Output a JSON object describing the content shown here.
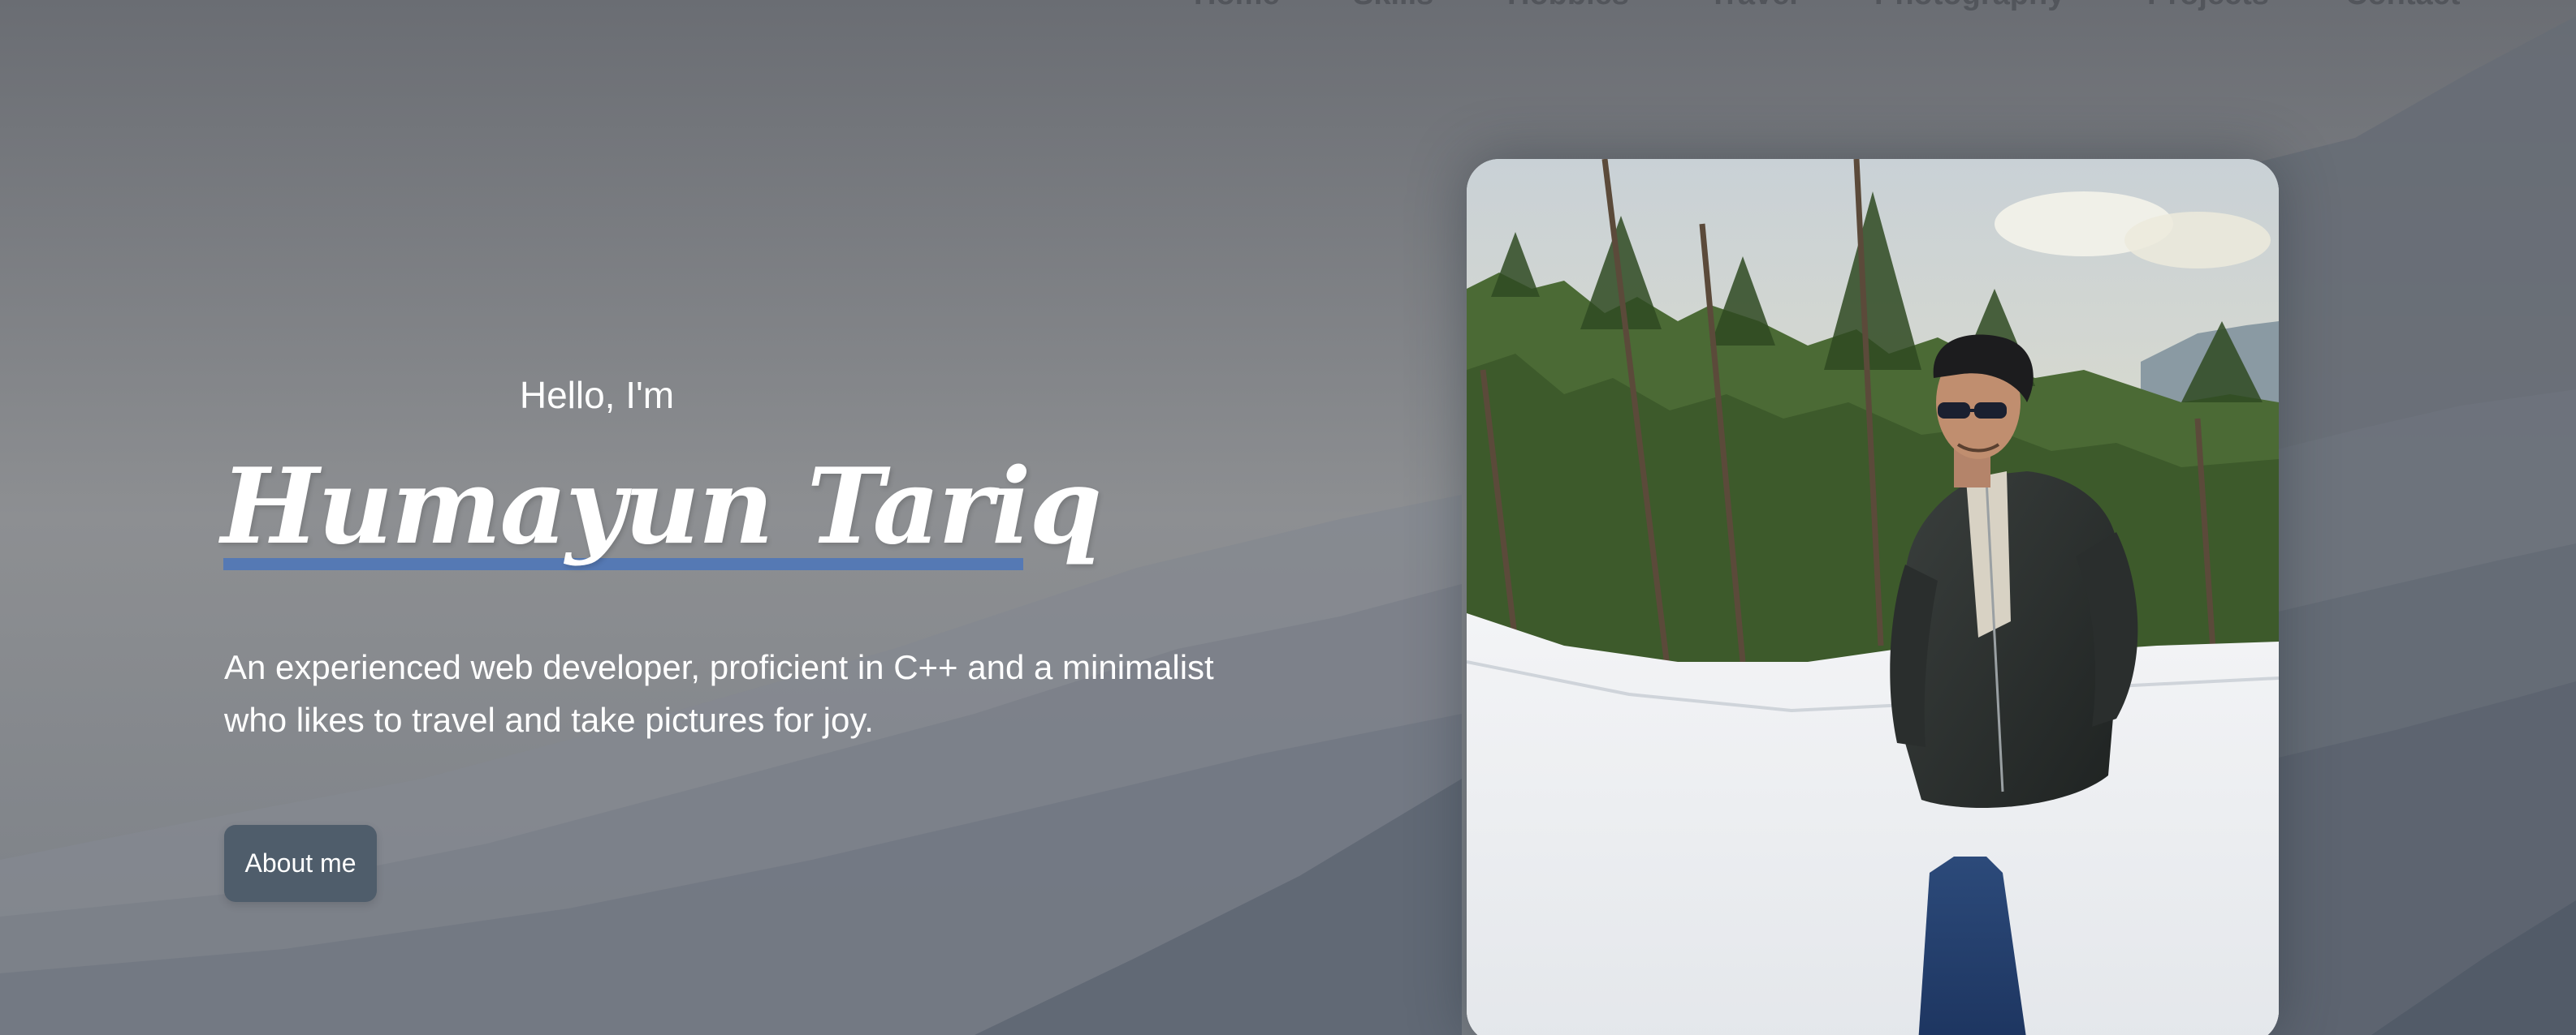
{
  "nav": {
    "items": [
      "Home",
      "Skills",
      "Hobbies",
      "Travel",
      "Photography",
      "Projects",
      "Contact"
    ]
  },
  "hero": {
    "greeting": "Hello, I'm",
    "name": "Humayun Tariq",
    "tagline": "An experienced web developer, proficient in C++ and a minimalist who likes to travel and take pictures for joy.",
    "about_button": "About me"
  },
  "colors": {
    "underline": "#5579b4",
    "button_bg": "#4f5d6b",
    "text": "#ffffff"
  }
}
